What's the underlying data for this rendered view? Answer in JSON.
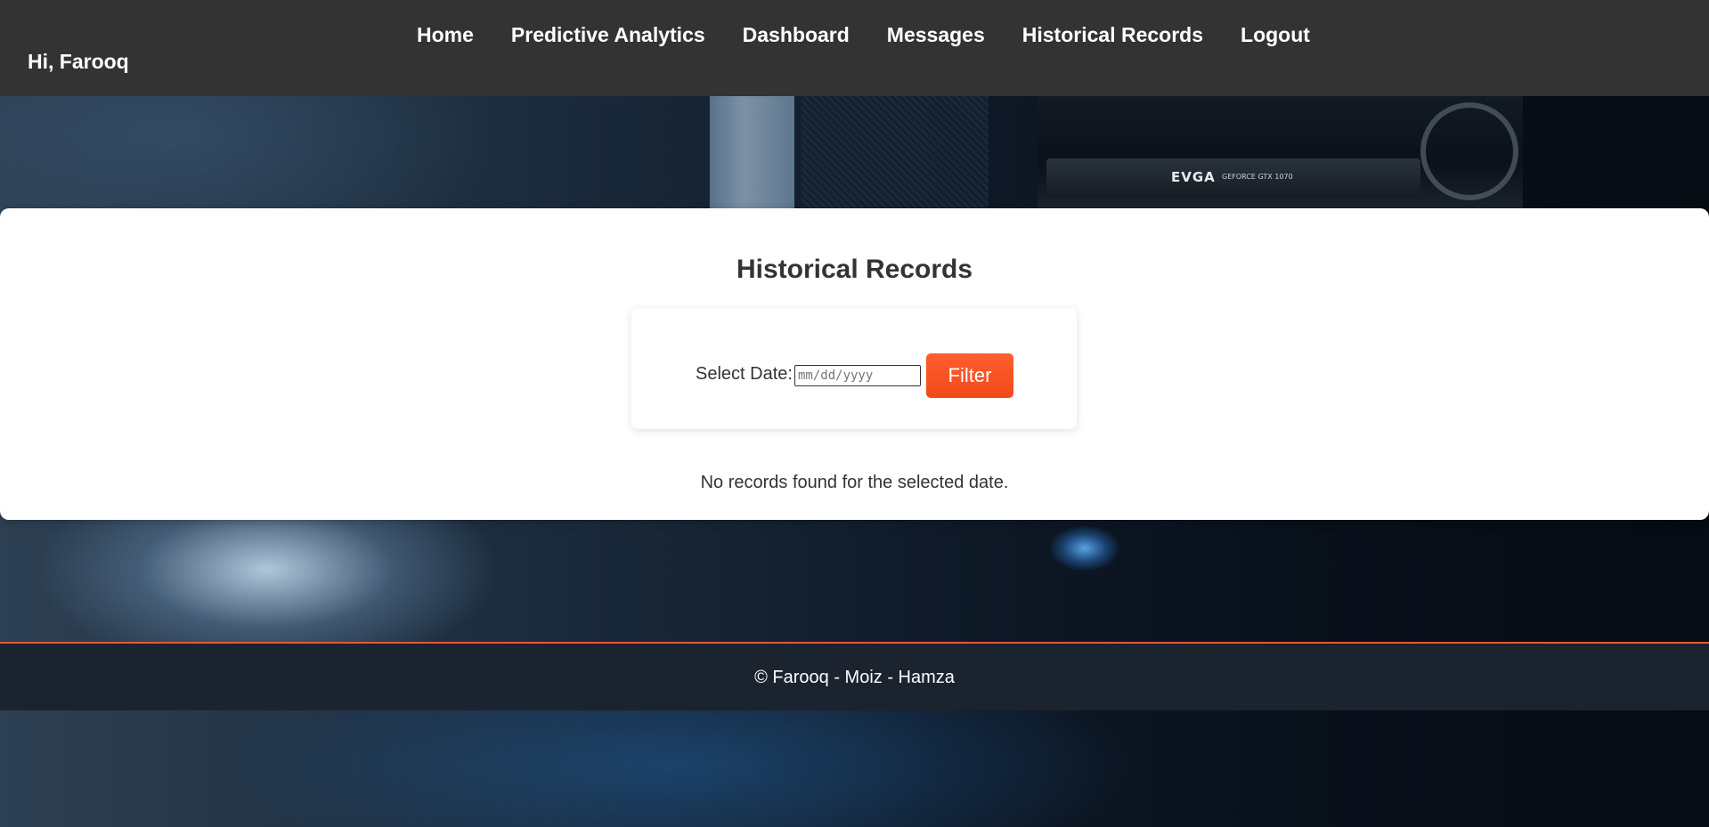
{
  "header": {
    "greeting": "Hi, Farooq",
    "nav": [
      {
        "label": "Home"
      },
      {
        "label": "Predictive Analytics"
      },
      {
        "label": "Dashboard"
      },
      {
        "label": "Messages"
      },
      {
        "label": "Historical Records"
      },
      {
        "label": "Logout"
      }
    ],
    "background_color": "#333333"
  },
  "main": {
    "title": "Historical Records",
    "filter": {
      "label": "Select Date:",
      "date_placeholder": "mm/dd/yyyy",
      "button_label": "Filter",
      "button_color": "#f5511f"
    },
    "empty_message": "No records found for the selected date."
  },
  "footer": {
    "text": "© Farooq - Moiz - Hamza",
    "accent_color": "#e8573a"
  },
  "background": {
    "gpu_brand": "EVGA",
    "gpu_model": "GEFORCE GTX 1070"
  }
}
